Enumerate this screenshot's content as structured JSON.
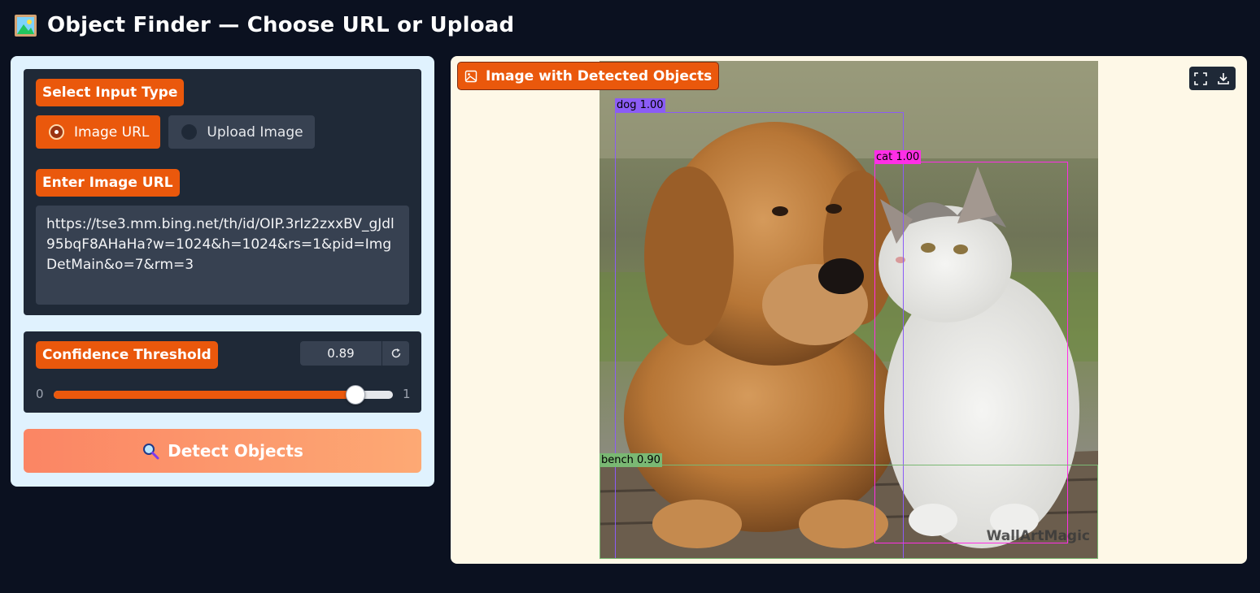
{
  "header": {
    "icon": "framed-picture-icon",
    "title": "Object Finder — Choose URL or Upload"
  },
  "input_section": {
    "label": "Select Input Type",
    "options": [
      {
        "label": "Image URL",
        "selected": true
      },
      {
        "label": "Upload Image",
        "selected": false
      }
    ],
    "url_label": "Enter Image URL",
    "url_value": "https://tse3.mm.bing.net/th/id/OIP.3rIz2zxxBV_gJdl95bqF8AHaHa?w=1024&h=1024&rs=1&pid=ImgDetMain&o=7&rm=3"
  },
  "threshold": {
    "label": "Confidence Threshold",
    "value": "0.89",
    "min_label": "0",
    "max_label": "1",
    "fraction": 0.89,
    "reset_icon": "reset-icon"
  },
  "detect_button": {
    "icon": "magnifier-icon",
    "label": "Detect Objects"
  },
  "output": {
    "label": "Image with Detected Objects",
    "label_icon": "image-icon",
    "toolbar": [
      "fullscreen-icon",
      "download-icon"
    ],
    "detections": [
      {
        "label": "dog 1.00",
        "color": "#8b5cf6"
      },
      {
        "label": "cat 1.00",
        "color": "#ff2ee6"
      },
      {
        "label": "bench 0.90",
        "color": "#7ab873"
      }
    ],
    "watermark": "WallArtMagic"
  },
  "colors": {
    "accent": "#ea580c",
    "panel_light": "#e0f2fe",
    "panel_dark": "#1f2937",
    "background": "#0b1120"
  }
}
